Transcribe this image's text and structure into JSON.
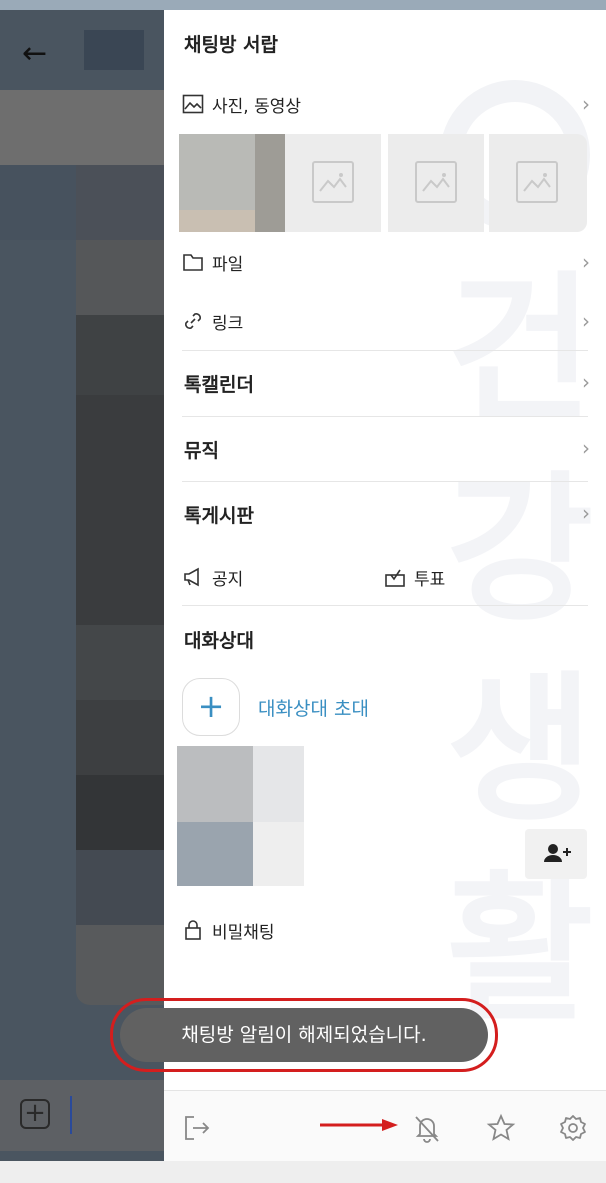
{
  "drawer": {
    "title": "채팅방 서랍",
    "media": {
      "label": "사진, 동영상",
      "icon": "image-icon"
    },
    "file": {
      "label": "파일",
      "icon": "folder-icon"
    },
    "link": {
      "label": "링크",
      "icon": "link-icon"
    },
    "sections": {
      "calendar": "톡캘린더",
      "music": "뮤직",
      "board": "톡게시판"
    },
    "notice": {
      "label": "공지",
      "icon": "megaphone-icon"
    },
    "vote": {
      "label": "투표",
      "icon": "vote-box-icon"
    },
    "members_title": "대화상대",
    "invite_label": "대화상대 초대",
    "secret_chat": {
      "label": "비밀채팅",
      "icon": "lock-icon"
    }
  },
  "toast": {
    "message": "채팅방 알림이 해제되었습니다."
  },
  "bottom_bar": {
    "icons": [
      "exit-icon",
      "bell-off-icon",
      "star-icon",
      "settings-icon"
    ]
  },
  "colors": {
    "accent": "#3a8fc2",
    "highlight": "#d41e1e",
    "toast_bg": "#616161"
  }
}
